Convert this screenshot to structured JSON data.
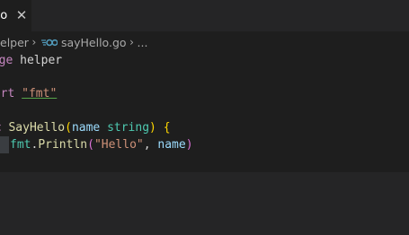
{
  "tab": {
    "label": "go",
    "close_glyph": "✕"
  },
  "breadcrumb": {
    "folder": "elper",
    "file": "sayHello.go",
    "more": "...",
    "sep": "›"
  },
  "code": {
    "line1_kw": "kage",
    "line1_rest": " helper",
    "line3_kw": "port",
    "line3_str": "\"fmt\"",
    "line5_kw": "nc",
    "line5_fn": "SayHello",
    "line5_open": "(",
    "line5_param": "name",
    "line5_type": "string",
    "line5_close": ")",
    "line5_brace": "{",
    "line6_pkg": "fmt",
    "line6_dot": ".",
    "line6_fn": "Println",
    "line6_open": "(",
    "line6_str": "\"Hello\"",
    "line6_comma": ",",
    "line6_arg": "name",
    "line6_close": ")"
  },
  "colors": {
    "editor_bg": "#1e1e1e",
    "chrome_bg": "#252526",
    "keyword": "#c586c0",
    "string": "#ce9178",
    "function": "#dcdcaa",
    "type": "#4ec9b0",
    "go_icon": "#519aba"
  },
  "icons": {
    "file": "go-file-icon",
    "close": "close-icon"
  }
}
